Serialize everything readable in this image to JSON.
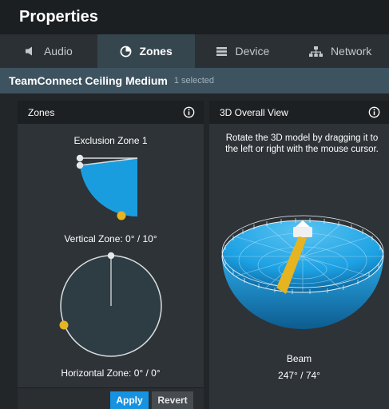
{
  "title": "Properties",
  "tabs": [
    {
      "label": "Audio",
      "icon": "speaker-icon"
    },
    {
      "label": "Zones",
      "icon": "zones-icon",
      "active": true
    },
    {
      "label": "Device",
      "icon": "device-icon"
    },
    {
      "label": "Network",
      "icon": "network-icon"
    }
  ],
  "device": {
    "name": "TeamConnect Ceiling Medium",
    "selected_text": "1 selected"
  },
  "zones_panel": {
    "title": "Zones",
    "exclusion_title": "Exclusion Zone 1",
    "vertical_label": "Vertical Zone: 0° / 10°",
    "horizontal_label": "Horizontal Zone: 0° / 0°",
    "apply_label": "Apply",
    "revert_label": "Revert"
  },
  "view3d_panel": {
    "title": "3D Overall View",
    "hint": "Rotate the 3D model by dragging it to the left or right with the mouse cursor.",
    "beam_title": "Beam",
    "beam_value": "247° / 74°"
  },
  "colors": {
    "accent": "#1692e0",
    "beam": "#e6b421",
    "zone_fill": "#1a9ddf",
    "panel": "#2e3337"
  }
}
